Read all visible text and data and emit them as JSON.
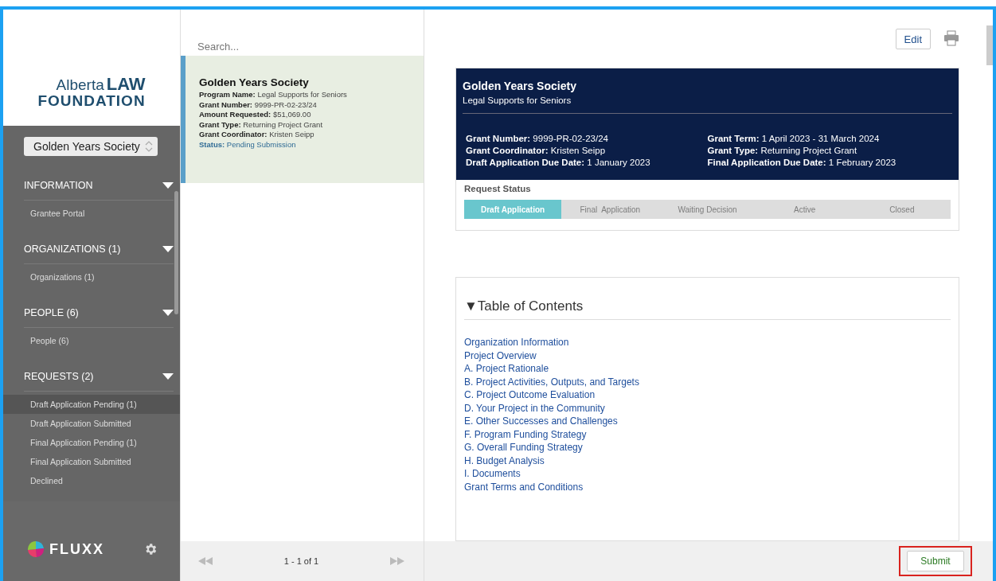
{
  "sidebar": {
    "logo": {
      "line_1": "Alberta",
      "line_1_bold": "LAW",
      "line_2": "FOUNDATION"
    },
    "org_select": {
      "value": "Golden Years Society"
    },
    "sections": [
      {
        "title": "INFORMATION",
        "expanded": true,
        "items": [
          {
            "label": "Grantee Portal",
            "selected": false
          }
        ]
      },
      {
        "title": "ORGANIZATIONS (1)",
        "expanded": true,
        "items": [
          {
            "label": "Organizations  (1)",
            "selected": false
          }
        ]
      },
      {
        "title": "PEOPLE (6)",
        "expanded": true,
        "items": [
          {
            "label": "People  (6)",
            "selected": false
          }
        ]
      },
      {
        "title": "REQUESTS (2)",
        "expanded": true,
        "items": [
          {
            "label": "Draft Application Pending  (1)",
            "selected": true
          },
          {
            "label": "Draft Application Submitted",
            "selected": false
          },
          {
            "label": "Final Application Pending  (1)",
            "selected": false
          },
          {
            "label": "Final Application Submitted",
            "selected": false
          },
          {
            "label": "Declined",
            "selected": false
          }
        ]
      }
    ],
    "footer": {
      "brand": "FLUXX"
    }
  },
  "list": {
    "search": {
      "placeholder": "Search..."
    },
    "cards": [
      {
        "title": "Golden Years Society",
        "selected": true,
        "fields": [
          {
            "label": "Program Name:",
            "value": "Legal Supports for Seniors",
            "kind": "plain"
          },
          {
            "label": "Grant Number:",
            "value": "9999-PR-02-23/24",
            "kind": "plain"
          },
          {
            "label": "Amount Requested:",
            "value": "$51,069.00",
            "kind": "plain"
          },
          {
            "label": "Grant Type:",
            "value": "Returning Project Grant",
            "kind": "plain"
          },
          {
            "label": "Grant Coordinator:",
            "value": "Kristen Seipp",
            "kind": "plain"
          },
          {
            "label": "Status:",
            "value": "Pending Submission",
            "kind": "status"
          }
        ]
      }
    ],
    "pager": {
      "text": "1 - 1 of 1"
    }
  },
  "detail": {
    "edit_button": "Edit",
    "header": {
      "title": "Golden Years Society",
      "subtitle": "Legal Supports for Seniors",
      "fields": [
        {
          "label": "Grant Number:",
          "value": "9999-PR-02-23/24"
        },
        {
          "label": "Grant Term:",
          "value": "1 April 2023 - 31 March 2024"
        },
        {
          "label": "Grant Coordinator:",
          "value": "Kristen Seipp"
        },
        {
          "label": "Grant Type:",
          "value": "Returning Project Grant"
        },
        {
          "label": "Draft Application Due Date:",
          "value": "1 January 2023"
        },
        {
          "label": "Final Application Due Date:",
          "value": "1 February 2023"
        }
      ]
    },
    "request_status": {
      "label": "Request Status",
      "steps": [
        {
          "label": "Draft Application",
          "selected": true
        },
        {
          "label": "Final  Application",
          "selected": false
        },
        {
          "label": "Waiting Decision",
          "selected": false
        },
        {
          "label": "Active",
          "selected": false
        },
        {
          "label": "Closed",
          "selected": false
        }
      ]
    },
    "toc": {
      "title": "▼Table of Contents",
      "links": [
        "Organization Information",
        "Project Overview",
        "A. Project Rationale",
        "B. Project Activities, Outputs, and Targets",
        "C. Project Outcome Evaluation",
        "D. Your Project in the Community",
        "E. Other Successes and Challenges",
        "F. Program Funding Strategy",
        "G. Overall Funding Strategy",
        "H. Budget Analysis",
        "I. Documents",
        "Grant Terms and Conditions"
      ]
    },
    "submit_button": "Submit"
  }
}
